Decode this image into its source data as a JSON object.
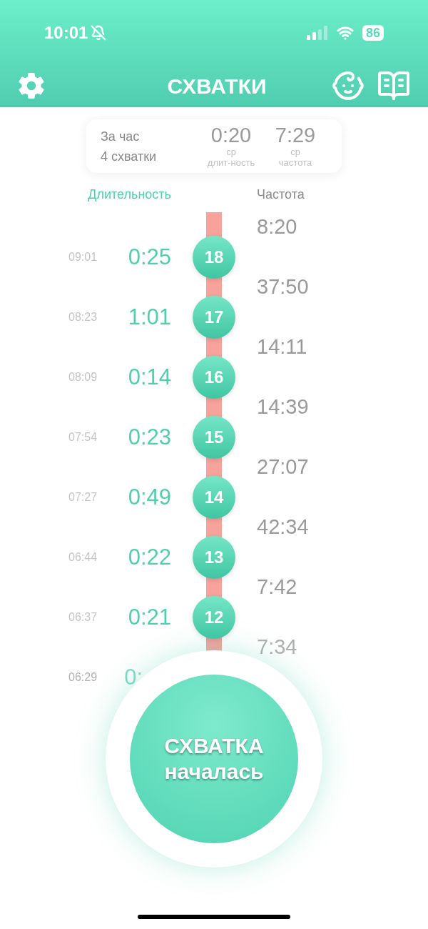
{
  "status_bar": {
    "time": "10:01",
    "battery": "86"
  },
  "header": {
    "title": "СХВАТКИ"
  },
  "summary": {
    "period": "За час",
    "count": "4 схватки",
    "stats": [
      {
        "value": "0:20",
        "label_1": "ср",
        "label_2": "длит-ность"
      },
      {
        "value": "7:29",
        "label_1": "ср",
        "label_2": "частота"
      }
    ]
  },
  "columns": {
    "duration": "Длительность",
    "frequency": "Частота"
  },
  "contractions": [
    {
      "frequency": "8:20",
      "time": "09:01",
      "duration": "0:25",
      "number": "18"
    },
    {
      "frequency": "37:50",
      "time": "08:23",
      "duration": "1:01",
      "number": "17"
    },
    {
      "frequency": "14:11",
      "time": "08:09",
      "duration": "0:14",
      "number": "16"
    },
    {
      "frequency": "14:39",
      "time": "07:54",
      "duration": "0:23",
      "number": "15"
    },
    {
      "frequency": "27:07",
      "time": "07:27",
      "duration": "0:49",
      "number": "14"
    },
    {
      "frequency": "42:34",
      "time": "06:44",
      "duration": "0:22",
      "number": "13"
    },
    {
      "frequency": "7:42",
      "time": "06:37",
      "duration": "0:21",
      "number": "12"
    },
    {
      "frequency": "7:34",
      "time": "06:29",
      "duration": "0:"
    }
  ],
  "start_button": {
    "line_1": "СХВАТКА",
    "line_2": "началась"
  }
}
